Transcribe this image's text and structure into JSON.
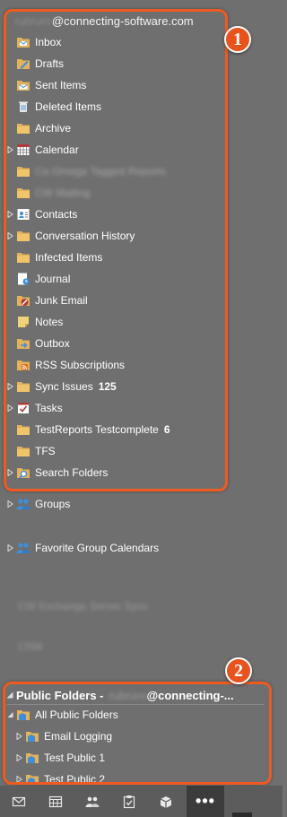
{
  "account": {
    "user_blurred": "rubruro",
    "domain": "@connecting-software.com"
  },
  "folders": [
    {
      "label": "Inbox",
      "icon": "inbox-icon",
      "expand": false,
      "count": ""
    },
    {
      "label": "Drafts",
      "icon": "drafts-icon",
      "expand": false,
      "count": ""
    },
    {
      "label": "Sent Items",
      "icon": "sent-items-icon",
      "expand": false,
      "count": ""
    },
    {
      "label": "Deleted Items",
      "icon": "deleted-items-icon",
      "expand": false,
      "count": ""
    },
    {
      "label": "Archive",
      "icon": "folder-icon",
      "expand": false,
      "count": ""
    },
    {
      "label": "Calendar",
      "icon": "calendar-icon",
      "expand": true,
      "count": ""
    },
    {
      "label": "Ca Omega Tagged Reports",
      "icon": "folder-icon",
      "expand": false,
      "count": "",
      "blurred": true
    },
    {
      "label": "CW Mailing",
      "icon": "folder-icon",
      "expand": false,
      "count": "",
      "blurred": true
    },
    {
      "label": "Contacts",
      "icon": "contacts-icon",
      "expand": true,
      "count": ""
    },
    {
      "label": "Conversation History",
      "icon": "folder-icon",
      "expand": true,
      "count": ""
    },
    {
      "label": "Infected Items",
      "icon": "folder-icon",
      "expand": false,
      "count": ""
    },
    {
      "label": "Journal",
      "icon": "journal-icon",
      "expand": false,
      "count": ""
    },
    {
      "label": "Junk Email",
      "icon": "junk-email-icon",
      "expand": false,
      "count": ""
    },
    {
      "label": "Notes",
      "icon": "notes-icon",
      "expand": false,
      "count": ""
    },
    {
      "label": "Outbox",
      "icon": "outbox-icon",
      "expand": false,
      "count": ""
    },
    {
      "label": "RSS Subscriptions",
      "icon": "rss-icon",
      "expand": false,
      "count": ""
    },
    {
      "label": "Sync Issues",
      "icon": "folder-icon",
      "expand": true,
      "count": "125"
    },
    {
      "label": "Tasks",
      "icon": "tasks-icon",
      "expand": true,
      "count": ""
    },
    {
      "label": "TestReports  Testcomplete",
      "icon": "folder-icon",
      "expand": false,
      "count": "6"
    },
    {
      "label": "TFS",
      "icon": "folder-icon",
      "expand": false,
      "count": ""
    },
    {
      "label": "Search Folders",
      "icon": "search-folder-icon",
      "expand": true,
      "count": ""
    }
  ],
  "groups": {
    "label": "Groups"
  },
  "favorite_group_calendars": {
    "label": "Favorite Group Calendars"
  },
  "blurred_items": [
    "CW Exchange Server Sync",
    "CRM"
  ],
  "public_folders": {
    "header_label": "Public Folders - ",
    "user_blurred": "rubruro",
    "domain": "@connecting-...",
    "items": [
      {
        "label": "All Public Folders",
        "expanded": true
      },
      {
        "label": "Email Logging",
        "expanded": false
      },
      {
        "label": "Test Public 1",
        "expanded": false
      },
      {
        "label": "Test Public 2",
        "expanded": false
      }
    ]
  },
  "callouts": {
    "one": "1",
    "two": "2"
  },
  "bottom_nav": [
    "mail-icon",
    "calendar-icon",
    "people-icon",
    "tasks-icon",
    "folders-icon",
    "more-icon"
  ],
  "more_label": "•••",
  "colors": {
    "accent": "#ef5a20",
    "pane": "#6f6f6f",
    "folder": "#e3b25c"
  }
}
